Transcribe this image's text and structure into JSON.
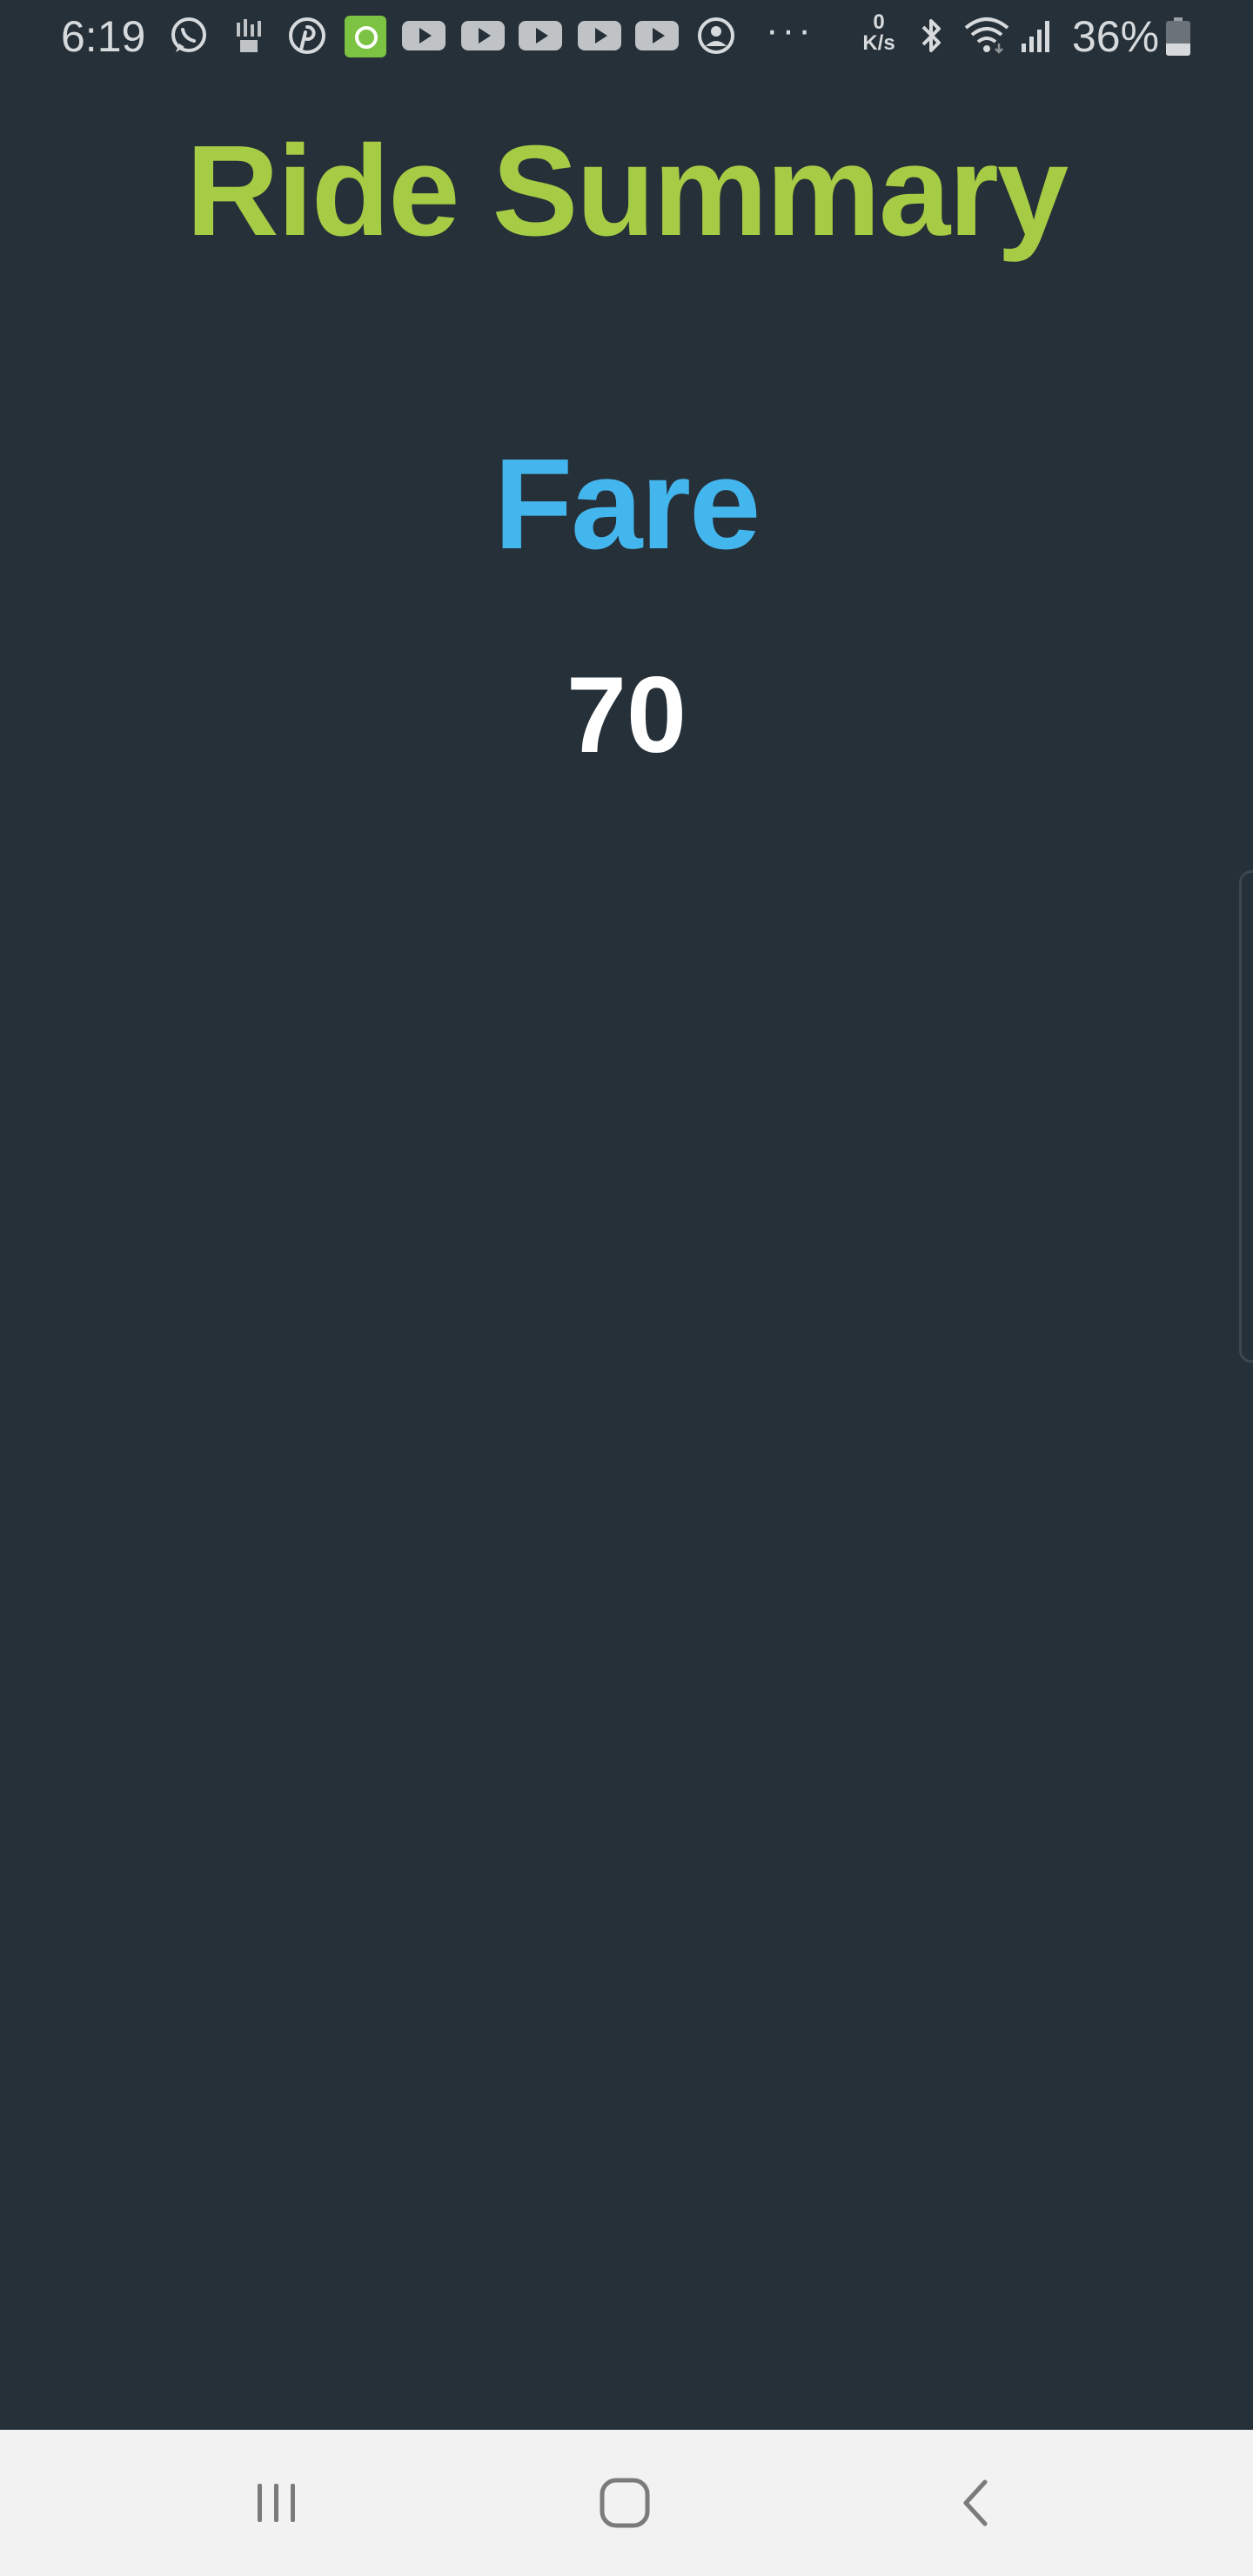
{
  "status_bar": {
    "time": "6:19",
    "net_speed_value": "0",
    "net_speed_unit": "K/s",
    "battery_percent": "36%",
    "battery_level": 0.36,
    "more_indicator": "···",
    "notification_icons": [
      "whatsapp-icon",
      "signal-app-icon",
      "pinterest-icon",
      "green-app-icon",
      "youtube-icon",
      "youtube-icon",
      "youtube-icon",
      "youtube-icon",
      "youtube-icon",
      "account-icon"
    ],
    "system_icons": [
      "bluetooth-icon",
      "wifi-icon",
      "cellular-signal-icon",
      "battery-icon"
    ]
  },
  "main": {
    "title": "Ride Summary",
    "fare_label": "Fare",
    "fare_value": "70"
  },
  "nav_bar": {
    "buttons": [
      "recent-apps-button",
      "home-button",
      "back-button"
    ]
  },
  "colors": {
    "background": "#263038",
    "title": "#a6cb45",
    "fare_label": "#44b6ee",
    "fare_value": "#ffffff",
    "nav_background": "#f2f2f2"
  }
}
